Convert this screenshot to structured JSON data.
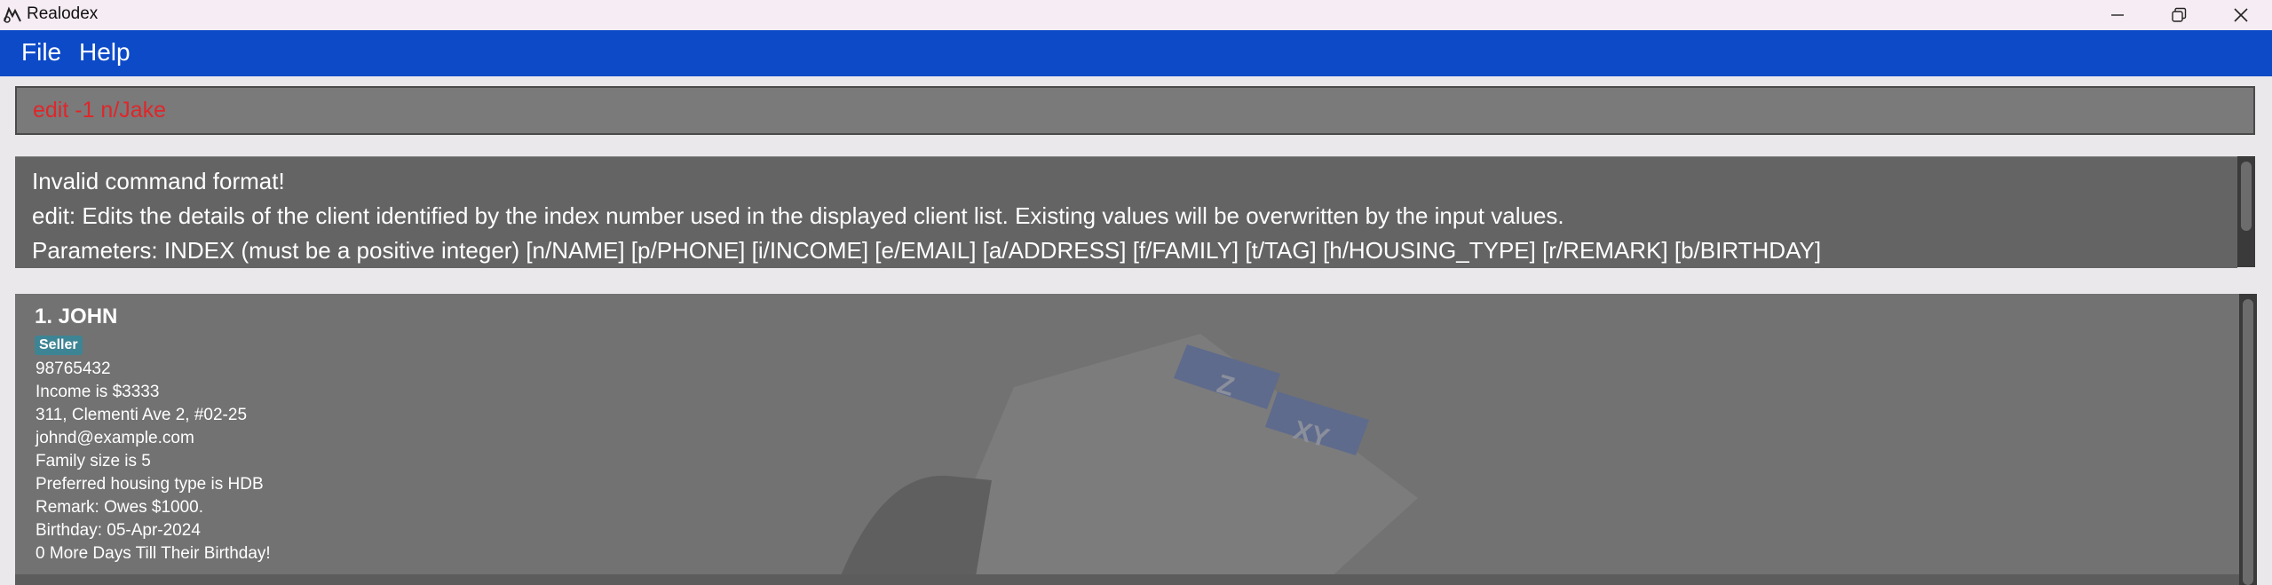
{
  "window": {
    "title": "Realodex"
  },
  "menu": {
    "file": "File",
    "help": "Help"
  },
  "command": {
    "value": "edit -1 n/Jake"
  },
  "result": {
    "lines": [
      "Invalid command format!",
      "edit: Edits the details of the client identified by the index number used in the displayed client list. Existing values will be overwritten by the input values.",
      "Parameters: INDEX (must be a positive integer) [n/NAME] [p/PHONE] [i/INCOME] [e/EMAIL] [a/ADDRESS] [f/FAMILY] [t/TAG] [h/HOUSING_TYPE] [r/REMARK] [b/BIRTHDAY]"
    ]
  },
  "clients": [
    {
      "header": "1.  JOHN",
      "tag": "Seller",
      "phone": "98765432",
      "income": "Income is $3333",
      "address": "311, Clementi Ave 2, #02-25",
      "email": "johnd@example.com",
      "family": "Family size is 5",
      "housing": "Preferred housing type is HDB",
      "remark": "Remark: Owes $1000.",
      "birthday": "Birthday: 05-Apr-2024",
      "countdown": "0 More Days Till Their Birthday!"
    }
  ],
  "background_art": {
    "tab1": "Z",
    "tab2": "XY"
  },
  "colors": {
    "menubar": "#0d4ac7",
    "command_text": "#e0262a",
    "tag": "#3d8494"
  }
}
